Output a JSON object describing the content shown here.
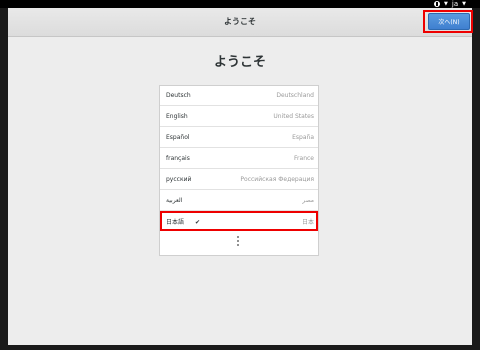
{
  "system": {
    "accessibility_icon": "accessibility-icon",
    "input_method": "ja"
  },
  "window": {
    "title": "ようこそ",
    "next_button_label": "次へ(N)"
  },
  "page": {
    "heading": "ようこそ"
  },
  "languages": [
    {
      "language": "Deutsch",
      "region": "Deutschland"
    },
    {
      "language": "English",
      "region": "United States"
    },
    {
      "language": "Español",
      "region": "España"
    },
    {
      "language": "français",
      "region": "France"
    },
    {
      "language": "русский",
      "region": "Российская Федерация"
    },
    {
      "language": "العربية",
      "region": "مصر"
    },
    {
      "language": "日本語",
      "region": "日本",
      "selected": true
    }
  ],
  "more_icon": "more-vertical-icon",
  "colors": {
    "accent": "#4a8ad8",
    "highlight": "#e00000"
  }
}
